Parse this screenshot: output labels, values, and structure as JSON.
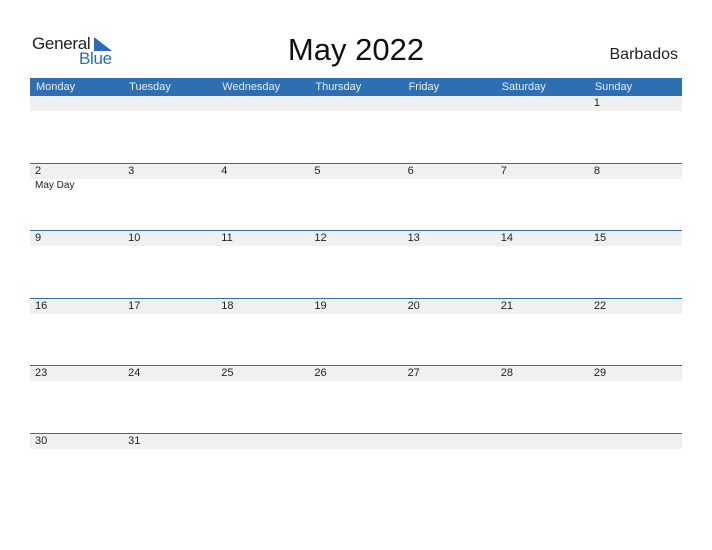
{
  "logo": {
    "line1": "General",
    "line2": "Blue"
  },
  "title": "May 2022",
  "country": "Barbados",
  "colors": {
    "accent": "#2e6fb1",
    "day_row_bg": "#f0f0f0"
  },
  "weekdays": [
    "Monday",
    "Tuesday",
    "Wednesday",
    "Thursday",
    "Friday",
    "Saturday",
    "Sunday"
  ],
  "weeks": [
    {
      "days": [
        "",
        "",
        "",
        "",
        "",
        "",
        "1"
      ],
      "events": [
        "",
        "",
        "",
        "",
        "",
        "",
        ""
      ]
    },
    {
      "days": [
        "2",
        "3",
        "4",
        "5",
        "6",
        "7",
        "8"
      ],
      "events": [
        "May Day",
        "",
        "",
        "",
        "",
        "",
        ""
      ]
    },
    {
      "days": [
        "9",
        "10",
        "11",
        "12",
        "13",
        "14",
        "15"
      ],
      "events": [
        "",
        "",
        "",
        "",
        "",
        "",
        ""
      ]
    },
    {
      "days": [
        "16",
        "17",
        "18",
        "19",
        "20",
        "21",
        "22"
      ],
      "events": [
        "",
        "",
        "",
        "",
        "",
        "",
        ""
      ]
    },
    {
      "days": [
        "23",
        "24",
        "25",
        "26",
        "27",
        "28",
        "29"
      ],
      "events": [
        "",
        "",
        "",
        "",
        "",
        "",
        ""
      ]
    },
    {
      "days": [
        "30",
        "31",
        "",
        "",
        "",
        "",
        ""
      ],
      "events": [
        "",
        "",
        "",
        "",
        "",
        "",
        ""
      ]
    }
  ]
}
